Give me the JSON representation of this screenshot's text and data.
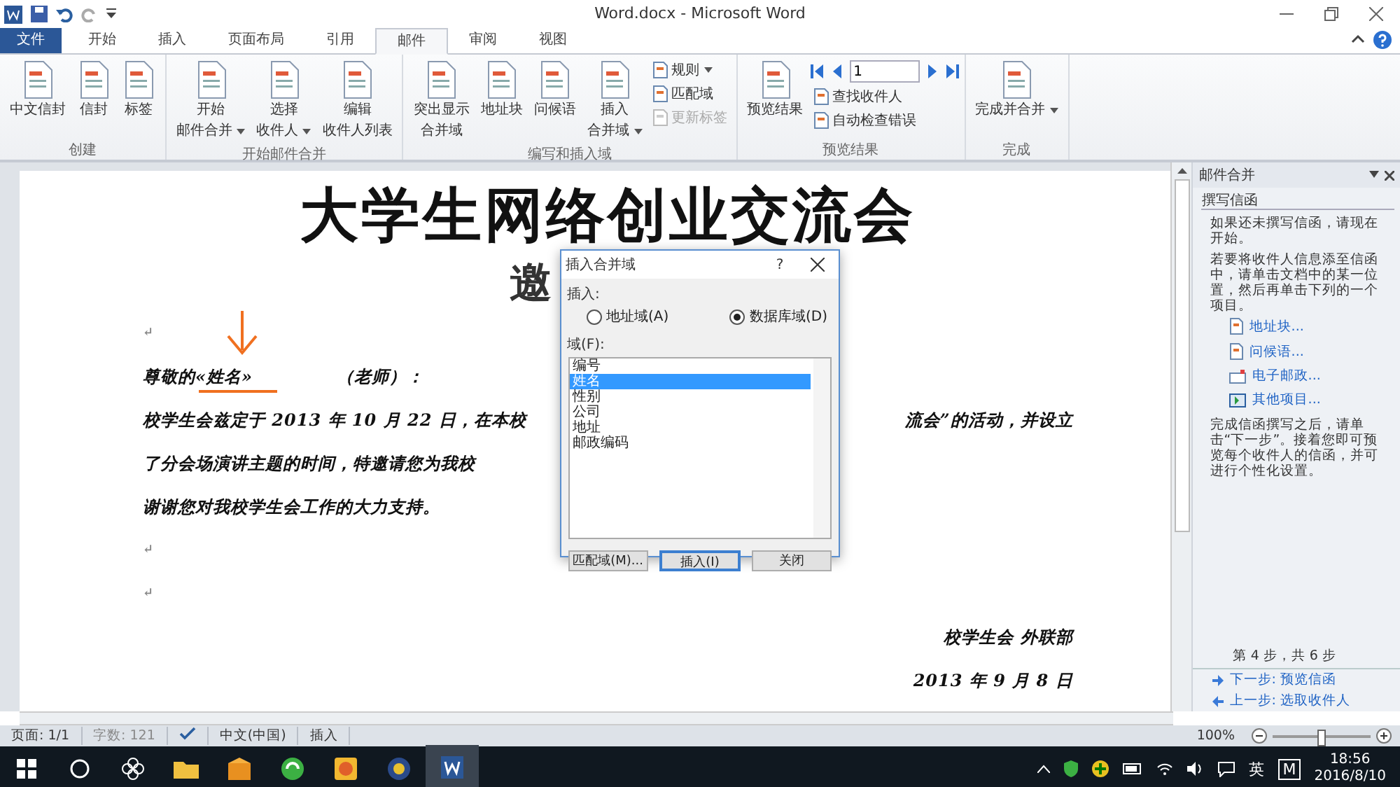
{
  "window": {
    "title": "Word.docx - Microsoft Word"
  },
  "tabs": [
    {
      "label": "文件",
      "selected": false,
      "kind": "file"
    },
    {
      "label": "开始",
      "selected": false,
      "kind": "tab"
    },
    {
      "label": "插入",
      "selected": false,
      "kind": "tab"
    },
    {
      "label": "页面布局",
      "selected": false,
      "kind": "tab"
    },
    {
      "label": "引用",
      "selected": false,
      "kind": "tab"
    },
    {
      "label": "邮件",
      "selected": true,
      "kind": "tab"
    },
    {
      "label": "审阅",
      "selected": false,
      "kind": "tab"
    },
    {
      "label": "视图",
      "selected": false,
      "kind": "tab"
    }
  ],
  "ribbon": {
    "groups": [
      {
        "label": "创建",
        "buttons": [
          {
            "kind": "large",
            "lines": [
              "中文信封"
            ],
            "dropdown": false
          },
          {
            "kind": "large",
            "lines": [
              "信封"
            ],
            "dropdown": false
          },
          {
            "kind": "large",
            "lines": [
              "标签"
            ],
            "dropdown": false
          }
        ]
      },
      {
        "label": "开始邮件合并",
        "buttons": [
          {
            "kind": "large",
            "lines": [
              "开始",
              "邮件合并"
            ],
            "dropdown": true
          },
          {
            "kind": "large",
            "lines": [
              "选择",
              "收件人"
            ],
            "dropdown": true
          },
          {
            "kind": "large",
            "lines": [
              "编辑",
              "收件人列表"
            ],
            "dropdown": false
          }
        ]
      },
      {
        "label": "编写和插入域",
        "buttons": [
          {
            "kind": "large",
            "lines": [
              "突出显示",
              "合并域"
            ],
            "dropdown": false
          },
          {
            "kind": "large",
            "lines": [
              "地址块"
            ],
            "dropdown": false
          },
          {
            "kind": "large",
            "lines": [
              "问候语"
            ],
            "dropdown": false
          },
          {
            "kind": "large",
            "lines": [
              "插入",
              "合并域"
            ],
            "dropdown": true
          },
          {
            "kind": "small",
            "label": "规则",
            "dropdown": true,
            "disabled": false
          },
          {
            "kind": "small",
            "label": "匹配域",
            "dropdown": false,
            "disabled": false
          },
          {
            "kind": "small",
            "label": "更新标签",
            "dropdown": false,
            "disabled": true
          }
        ]
      },
      {
        "label": "预览结果",
        "buttons": [
          {
            "kind": "large",
            "lines": [
              "预览结果"
            ],
            "dropdown": false
          },
          {
            "kind": "nav",
            "value": "1"
          },
          {
            "kind": "small",
            "label": "查找收件人",
            "dropdown": false,
            "disabled": false
          },
          {
            "kind": "small",
            "label": "自动检查错误",
            "dropdown": false,
            "disabled": false
          }
        ]
      },
      {
        "label": "完成",
        "buttons": [
          {
            "kind": "large",
            "lines": [
              "完成并合并"
            ],
            "dropdown": true
          }
        ]
      }
    ]
  },
  "document": {
    "title": "大学生网络创业交流会",
    "subtitle": "邀",
    "blank_marks": [
      "↵"
    ],
    "end_marks": [
      "↵",
      "↵"
    ],
    "salutation": {
      "before": "尊敬的",
      "field": "«姓名»",
      "after": "（老师）："
    },
    "lines": [
      {
        "left": "校学生会兹定于 2013 年 10 月 22 日，在本校",
        "right": "流会”的活动，并设立"
      },
      {
        "left": "了分会场演讲主题的时间，特邀请您为我校"
      },
      {
        "left": "谢谢您对我校学生会工作的大力支持。"
      }
    ],
    "signature": "校学生会  外联部",
    "date": "2013 年 9 月 8 日"
  },
  "dialog": {
    "title": "插入合并域",
    "help": "?",
    "insert_label": "插入:",
    "radios": [
      {
        "label": "地址域(A)",
        "selected": false
      },
      {
        "label": "数据库域(D)",
        "selected": true
      }
    ],
    "fields_label": "域(F):",
    "fields": [
      {
        "label": "编号",
        "selected": false
      },
      {
        "label": "姓名",
        "selected": true
      },
      {
        "label": "性别",
        "selected": false
      },
      {
        "label": "公司",
        "selected": false
      },
      {
        "label": "地址",
        "selected": false
      },
      {
        "label": "邮政编码",
        "selected": false
      }
    ],
    "buttons": [
      {
        "label": "匹配域(M)...",
        "default": false
      },
      {
        "label": "插入(I)",
        "default": true
      },
      {
        "label": "关闭",
        "default": false
      }
    ]
  },
  "pane": {
    "title": "邮件合并",
    "section": "撰写信函",
    "intro": [
      "如果还未撰写信函，请现在开始。",
      "若要将收件人信息添至信函中，请单击文档中的某一位置，然后再单击下列的一个项目。"
    ],
    "links": [
      {
        "kind": "address",
        "label": "地址块..."
      },
      {
        "kind": "greeting",
        "label": "问候语..."
      },
      {
        "kind": "email",
        "label": "电子邮政..."
      },
      {
        "kind": "more",
        "label": "其他项目..."
      }
    ],
    "outro": "完成信函撰写之后，请单击“下一步”。接着您即可预览每个收件人的信函，并可进行个性化设置。",
    "step": "第 4 步，共 6 步",
    "nav": [
      {
        "kind": "next",
        "label": "下一步: 预览信函"
      },
      {
        "kind": "prev",
        "label": "上一步: 选取收件人"
      }
    ]
  },
  "status_bar": {
    "page": "页面: 1/1",
    "words": "字数: 121",
    "language": "中文(中国)",
    "mode": "插入",
    "zoom": "100%",
    "zoom_slider": {
      "level": 0.5
    }
  },
  "taskbar": {
    "apps": [
      {
        "kind": "folder",
        "selected": false
      },
      {
        "kind": "package",
        "selected": false
      },
      {
        "kind": "globe",
        "selected": false
      },
      {
        "kind": "game",
        "selected": false
      },
      {
        "kind": "badge",
        "selected": false
      },
      {
        "kind": "word",
        "selected": true
      }
    ],
    "ime": "英",
    "ime_mode": "M",
    "time": "18:56",
    "date": "2016/8/10"
  }
}
